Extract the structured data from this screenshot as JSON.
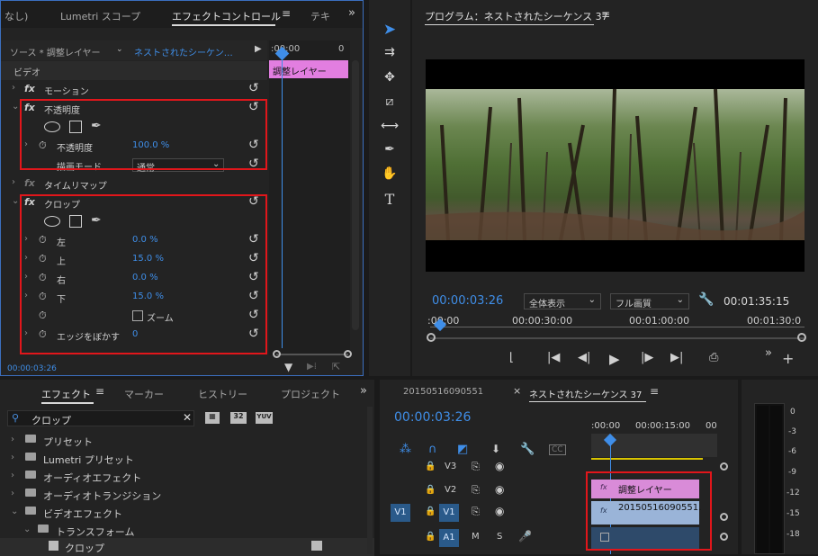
{
  "effect_controls": {
    "tabs": [
      "なし)",
      "Lumetri スコープ",
      "エフェクトコントロール",
      "テキ"
    ],
    "source_label": "ソース * 調整レイヤー",
    "sequence_label": "ネストされたシーケン…",
    "timecode_ruler": ":00:00",
    "clip_label": "調整レイヤー",
    "video_header": "ビデオ",
    "motion": "モーション",
    "opacity": {
      "name": "不透明度",
      "prop": "不透明度",
      "value": "100.0 %",
      "blend_label": "描画モード",
      "blend_value": "通常"
    },
    "time_remap": "タイムリマップ",
    "crop": {
      "name": "クロップ",
      "left": {
        "label": "左",
        "value": "0.0 %"
      },
      "top": {
        "label": "上",
        "value": "15.0 %"
      },
      "right": {
        "label": "右",
        "value": "0.0 %"
      },
      "bottom": {
        "label": "下",
        "value": "15.0 %"
      },
      "zoom": "ズーム",
      "feather": {
        "label": "エッジをぼかす",
        "value": "0"
      }
    },
    "timecode": "00:00:03:26"
  },
  "program": {
    "title": "プログラム：ネストされたシーケンス 37",
    "timecode": "00:00:03:26",
    "fit": "全体表示",
    "quality": "フル画質",
    "duration": "00:01:35:15",
    "ruler": [
      ":00:00",
      "00:00:30:00",
      "00:01:00:00",
      "00:01:30:0"
    ]
  },
  "effects": {
    "tabs": [
      "エフェクト",
      "マーカー",
      "ヒストリー",
      "プロジェクト"
    ],
    "search": "クロップ",
    "items": [
      "プリセット",
      "Lumetri プリセット",
      "オーディオエフェクト",
      "オーディオトランジション",
      "ビデオエフェクト",
      "トランスフォーム",
      "クロップ"
    ],
    "badges": [
      "32",
      "YUV"
    ]
  },
  "timeline": {
    "tabs": [
      "20150516090551",
      "ネストされたシーケンス 37"
    ],
    "timecode": "00:00:03:26",
    "ruler": [
      ":00:00",
      "00:00:15:00",
      "00"
    ],
    "tracks": {
      "v3": "V3",
      "v2": "V2",
      "v1": "V1",
      "src_v1": "V1",
      "a1": "A1",
      "m": "M",
      "s": "S"
    },
    "clips": {
      "adjust": "調整レイヤー",
      "nested": "20150516090551."
    },
    "fx_label": "fx"
  },
  "meter": {
    "ticks": [
      "0",
      "-3",
      "-6",
      "-9",
      "-12",
      "-15",
      "-18"
    ]
  }
}
